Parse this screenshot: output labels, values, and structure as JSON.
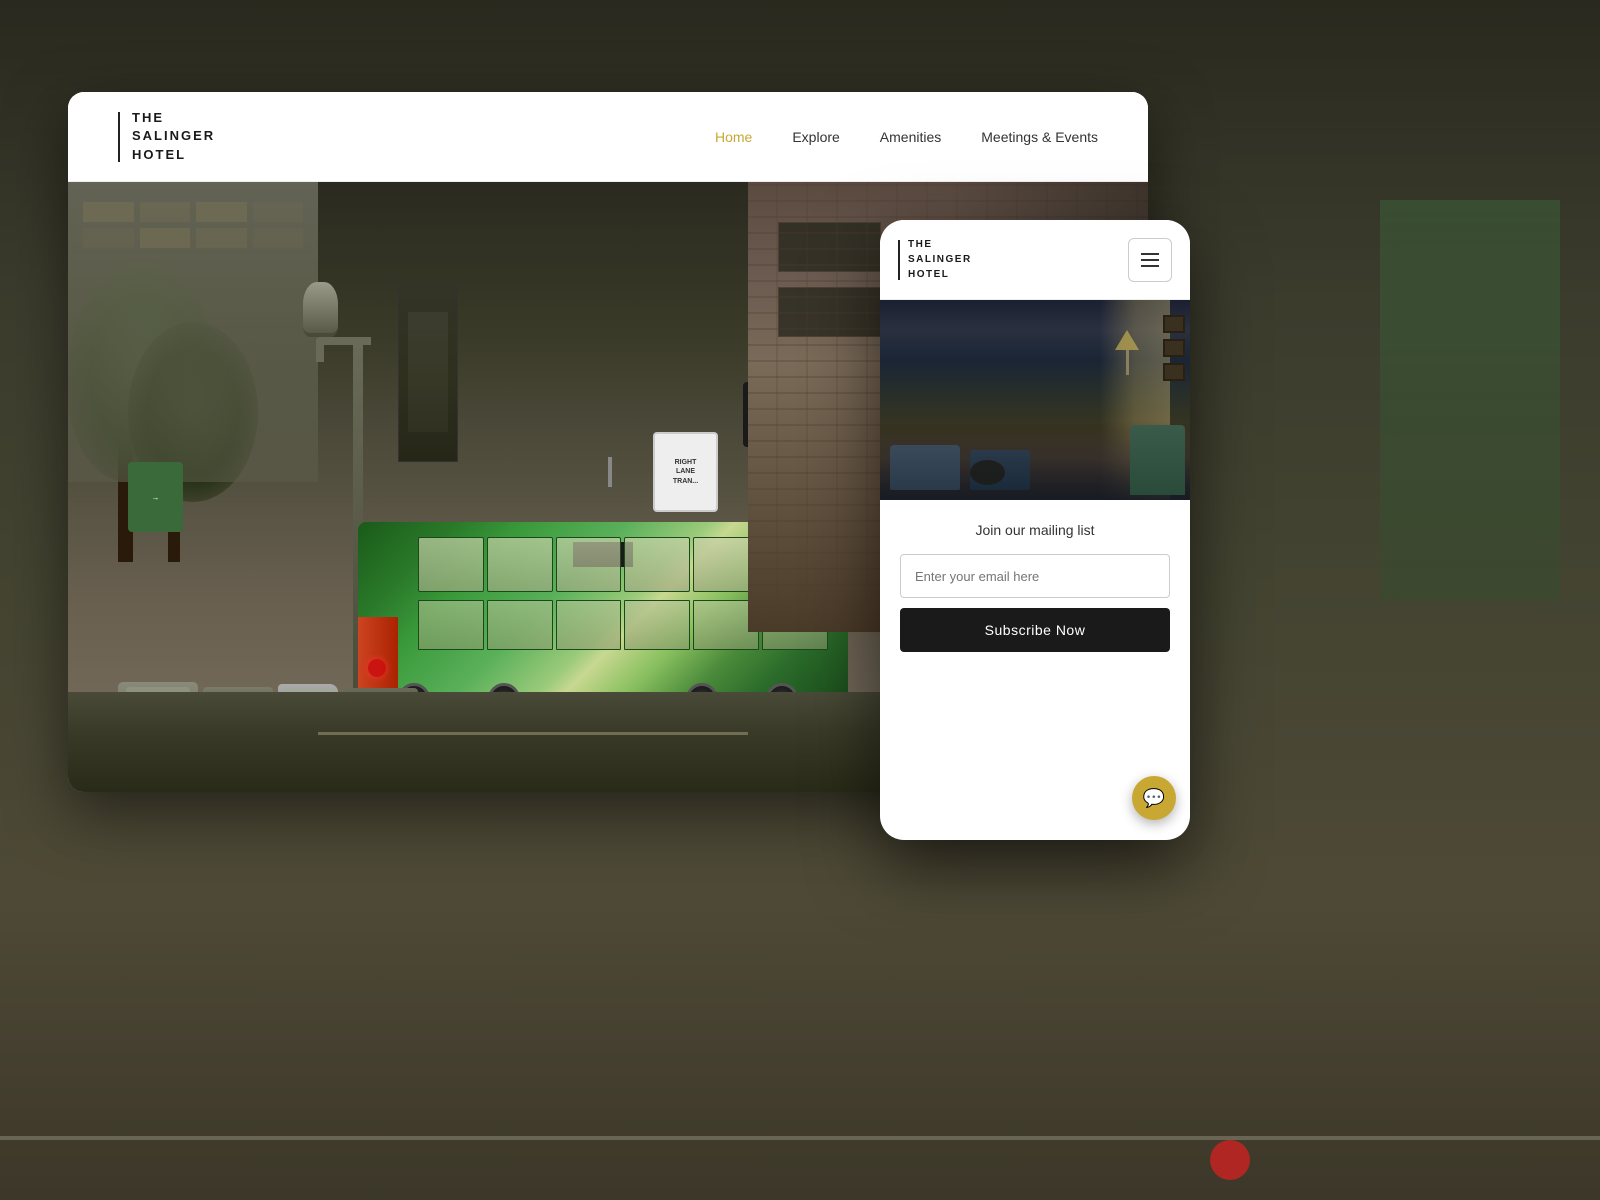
{
  "page": {
    "background": "#3a3a2e"
  },
  "desktop": {
    "logo": {
      "line1": "THE",
      "line2": "SALINGER",
      "line3": "HOTEL"
    },
    "nav": {
      "items": [
        {
          "label": "Home",
          "active": true
        },
        {
          "label": "Explore",
          "active": false
        },
        {
          "label": "Amenities",
          "active": false
        },
        {
          "label": "Meetings & Events",
          "active": false
        }
      ]
    }
  },
  "mobile": {
    "logo": {
      "line1": "THE",
      "line2": "SALINGER",
      "line3": "HOTEL"
    },
    "hamburger_label": "☰",
    "mailing": {
      "title": "Join our mailing list",
      "email_placeholder": "Enter your email here",
      "subscribe_label": "Subscribe Now"
    },
    "chat_icon": "💬"
  }
}
